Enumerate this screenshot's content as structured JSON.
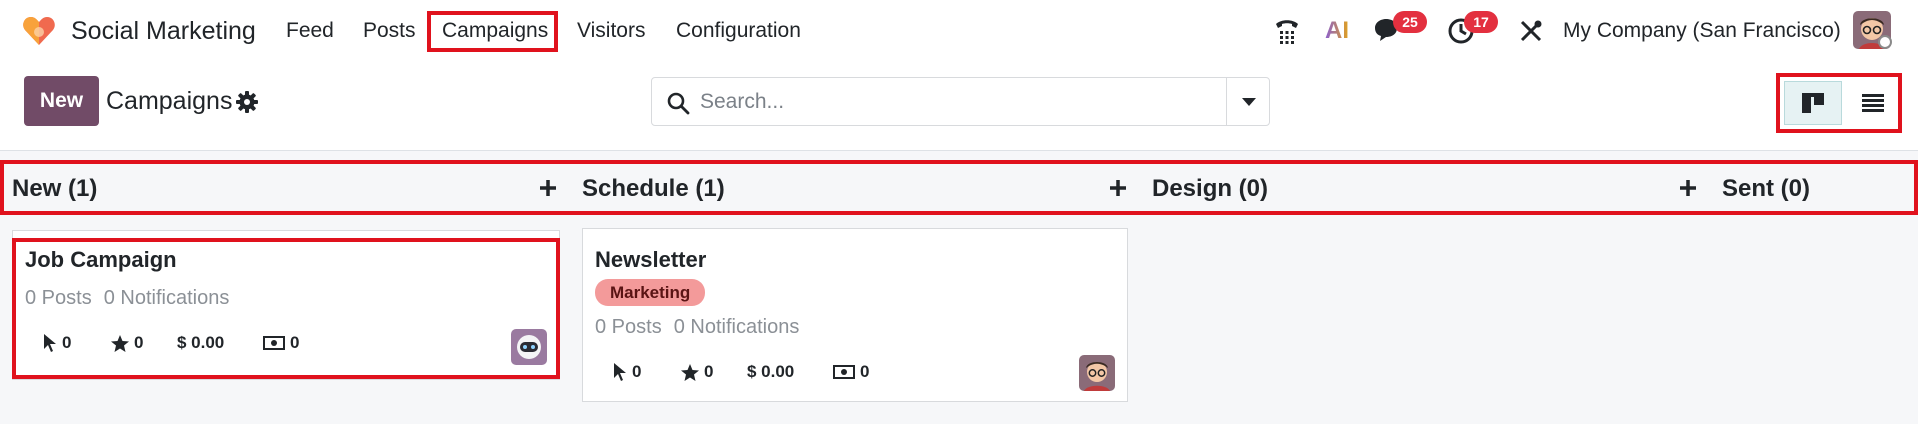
{
  "app": {
    "title": "Social Marketing"
  },
  "menu": [
    {
      "label": "Feed"
    },
    {
      "label": "Posts"
    },
    {
      "label": "Campaigns"
    },
    {
      "label": "Visitors"
    },
    {
      "label": "Configuration"
    }
  ],
  "systray": {
    "messages_count": "25",
    "activities_count": "17",
    "company": "My Company (San Francisco)",
    "ai_label": "AI"
  },
  "control": {
    "new_label": "New",
    "breadcrumb": "Campaigns",
    "search_placeholder": "Search..."
  },
  "columns": [
    {
      "title": "New (1)"
    },
    {
      "title": "Schedule (1)"
    },
    {
      "title": "Design (0)"
    },
    {
      "title": "Sent (0)"
    }
  ],
  "cards": [
    {
      "name": "Job Campaign",
      "posts": "0 Posts",
      "notifications": "0 Notifications",
      "clicks": "0",
      "favorites": "0",
      "revenue": "$ 0.00",
      "cash": "0"
    },
    {
      "name": "Newsletter",
      "tag": "Marketing",
      "posts": "0 Posts",
      "notifications": "0 Notifications",
      "clicks": "0",
      "favorites": "0",
      "revenue": "$ 0.00",
      "cash": "0"
    }
  ],
  "colors": {
    "primary": "#714b67",
    "highlight": "#e0121d",
    "badge": "#e3303f",
    "tag": "#f39a9a"
  }
}
